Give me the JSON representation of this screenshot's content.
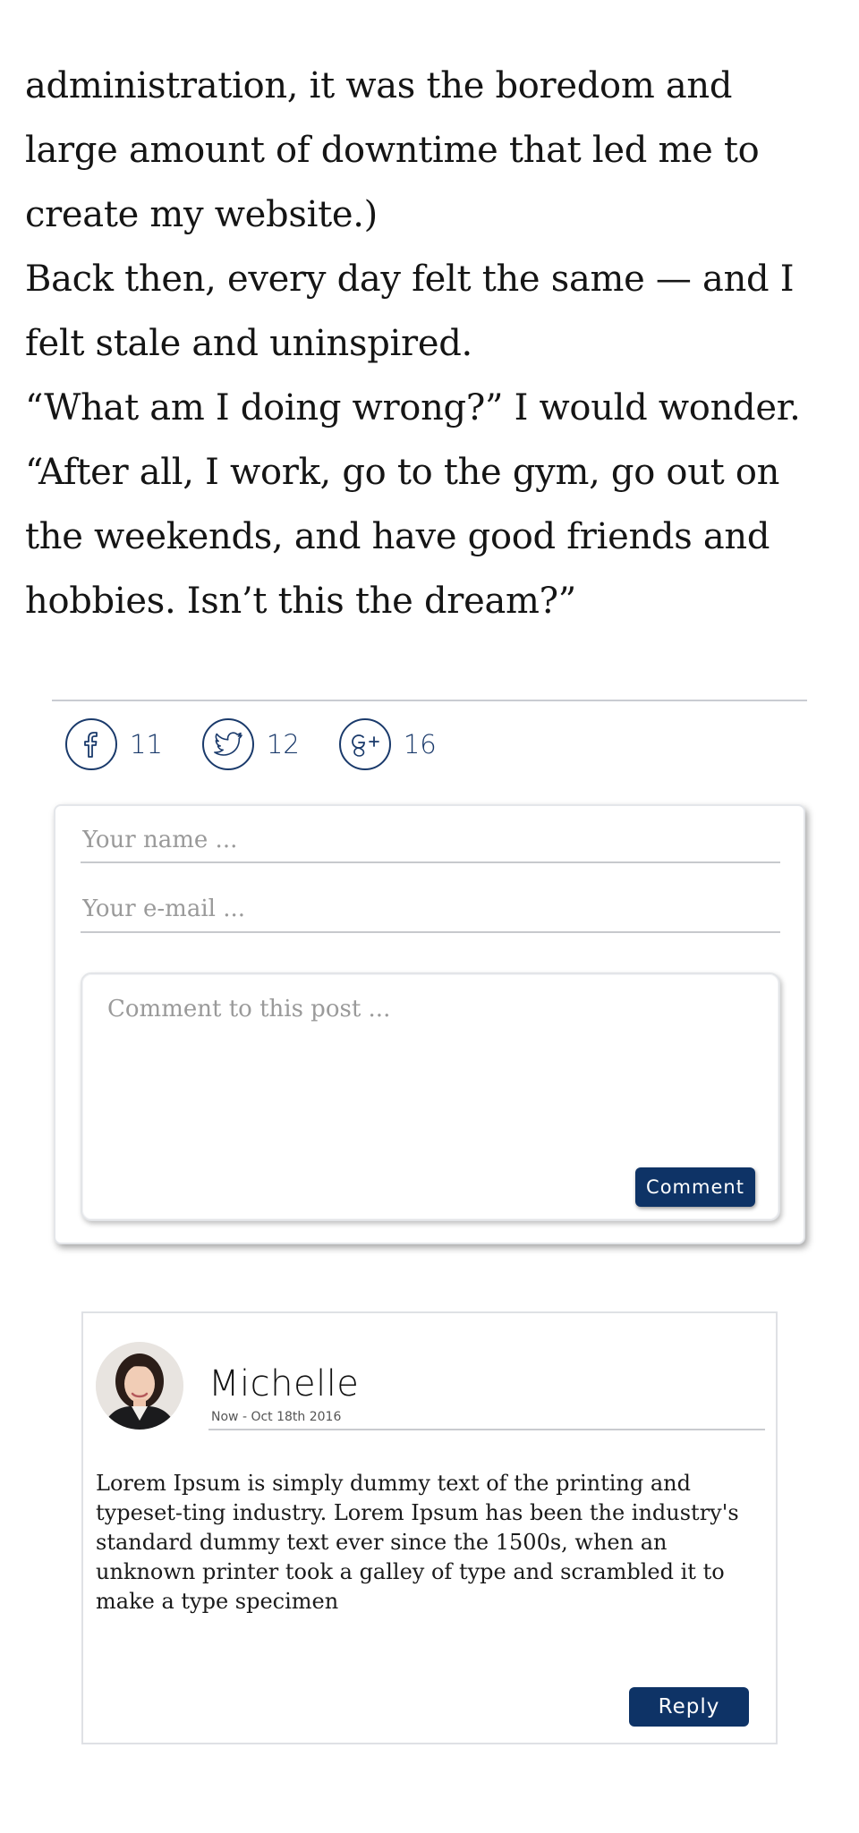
{
  "article": {
    "paragraphs": [
      "administration, it was the boredom and large amount of downtime that led me to create my website.)",
      "Back then, every day felt the same — and I felt stale and uninspired.",
      "“What am I doing wrong?” I would wonder. “After all, I work, go to the gym, go out on the weekends, and have good friends and hobbies. Isn’t this the dream?”"
    ]
  },
  "share": {
    "facebook_count": "11",
    "twitter_count": "12",
    "googleplus_count": "16",
    "icon_color": "#1a3a6b"
  },
  "form": {
    "name_placeholder": "Your name ...",
    "email_placeholder": "Your e-mail ...",
    "comment_placeholder": "Comment to this post ...",
    "submit_label": "Comment"
  },
  "comment": {
    "author": "Michelle",
    "date": "Now - Oct 18th 2016",
    "text": "Lorem Ipsum is simply dummy text of the printing and typeset-ting industry. Lorem Ipsum has been the industry's standard dummy text ever since the 1500s, when an unknown printer took a galley of type and scrambled it to make a type specimen",
    "reply_label": "Reply"
  },
  "colors": {
    "button_bg": "#0e3366",
    "divider": "#c9ccd2"
  }
}
